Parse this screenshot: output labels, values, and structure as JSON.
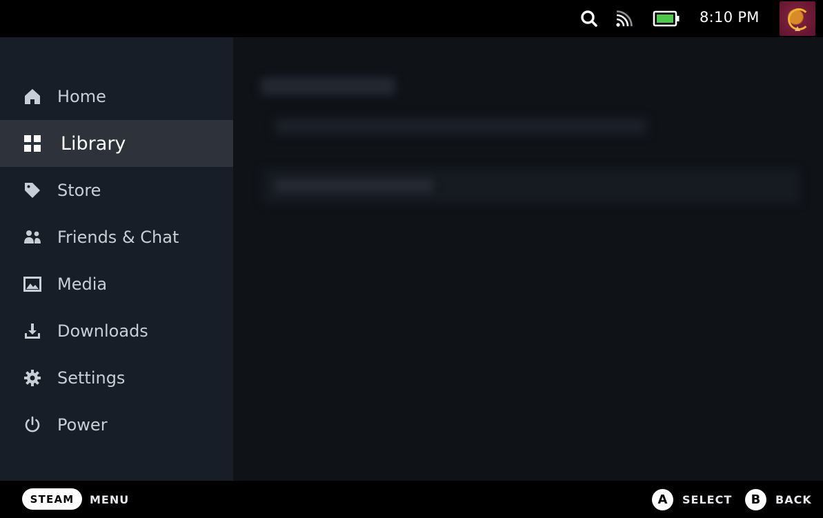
{
  "status_bar": {
    "time": "8:10 PM",
    "icons": [
      "search-icon",
      "wifi-icon",
      "battery-icon",
      "avatar"
    ],
    "battery_color": "#4cc84a"
  },
  "sidebar": {
    "items": [
      {
        "label": "Home",
        "icon": "home-icon"
      },
      {
        "label": "Library",
        "icon": "grid-icon",
        "active": true
      },
      {
        "label": "Store",
        "icon": "tag-icon"
      },
      {
        "label": "Friends & Chat",
        "icon": "friends-icon"
      },
      {
        "label": "Media",
        "icon": "image-icon"
      },
      {
        "label": "Downloads",
        "icon": "download-icon"
      },
      {
        "label": "Settings",
        "icon": "gear-icon"
      },
      {
        "label": "Power",
        "icon": "power-icon"
      }
    ]
  },
  "bottom_bar": {
    "steam_label": "STEAM",
    "menu_label": "MENU",
    "a_button": "A",
    "select_label": "SELECT",
    "b_button": "B",
    "back_label": "BACK"
  },
  "colors": {
    "sidebar_bg": "#181e27",
    "active_item_bg": "#2d323b",
    "bar_bg": "#000000"
  }
}
